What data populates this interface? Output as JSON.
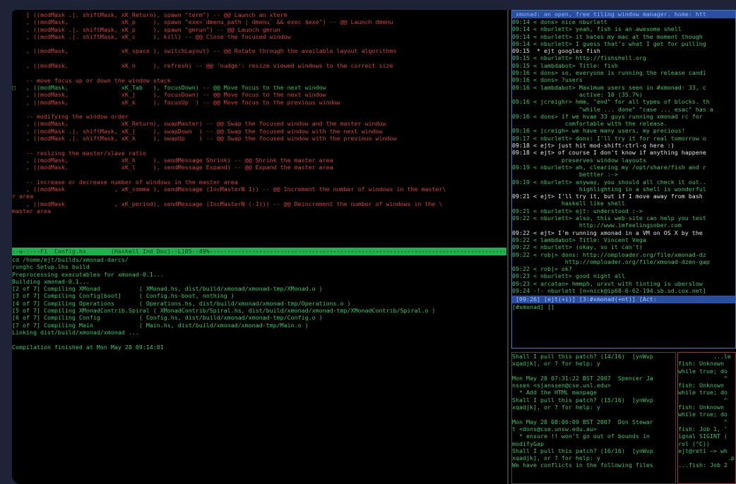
{
  "emacs": {
    "code_lines": [
      "    [ ((modMask .|. shiftMask, xK_Return), spawn \"term\") -- @@ Launch an xterm",
      "    , ((modMask,               xK_p     ), spawn \"exe=`dmenu_path | dmenu` && exec $exe\") -- @@ Launch dmenu",
      "    , ((modMask .|. shiftMask, xK_p     ), spawn \"gmrun\") -- @@ Launch gmrun",
      "    , ((modMask .|. shiftMask, xK_c     ), kill) -- @@ Close the focused window",
      "",
      "    , ((modMask,               xK_space ), switchLayout) -- @@ Rotate through the available layout algorithms",
      "",
      "    , ((modMask,               xK_n     ), refresh) -- @@ 'nudge': resize viewed windows to the correct size",
      "",
      "    -- move focus up or down the window stack",
      "□   , ((modMask,               xK_Tab   ), focusDown) -- @@ Move focus to the next window",
      "    , ((modMask,               xK_j     ), focusDown) -- @@ Move focus to the next window",
      "    , ((modMask,               xK_k     ), focusUp  ) -- @@ Move focus to the previous window",
      "",
      "    -- modifying the window order",
      "    , ((modMask,               xK_Return), swapMaster) -- @@ Swap the focused window and the master window",
      "    , ((modMask .|. shiftMask, xK_j     ), swapDown  ) -- @@ Swap the focused window with the next window",
      "    , ((modMask .|. shiftMask, xK_k     ), swapUp    ) -- @@ Swap the focused window with the previous window",
      "",
      "    -- resizing the master/slave ratio",
      "    , ((modMask,               xK_h     ), sendMessage Shrink) -- @@ Shrink the master area",
      "    , ((modMask,               xK_l     ), sendMessage Expand) -- @@ Expand the master area",
      "",
      "    -- increase or decrease number of windows in the master area",
      "    , ((modMask              , xK_comma ), sendMessage (IncMasterN 1)) -- @@ Increment the number of windows in the master\\",
      "r area",
      "    , ((modMask              , xK_period), sendMessage (IncMasterN (-1))) -- @@ Deincrement the number of windows in the \\",
      "master area"
    ],
    "modeline": "--u-:---F1  Config.hs       (Haskell Ind Doc)--L105--49%-------------------------------------------------------------------------------------",
    "compile_lines": [
      "cd /home/ejt/builds/xmonad-darcs/",
      "runghc Setup.lhs build",
      "Preprocessing executables for xmonad-0.1...",
      "Building xmonad-0.1...",
      "[2 of 7] Compiling XMonad           ( XMonad.hs, dist/build/xmonad/xmonad-tmp/XMonad.o )",
      "[3 of 7] Compiling Config[boot]     ( Config.hs-boot, nothing )",
      "[4 of 7] Compiling Operations       ( Operations.hs, dist/build/xmonad/xmonad-tmp/Operations.o )",
      "[5 of 7] Compiling XMonadContrib.Spiral ( XMonadContrib/Spiral.hs, dist/build/xmonad/xmonad-tmp/XMonadContrib/Spiral.o )",
      "[6 of 7] Compiling Config           ( Config.hs, dist/build/xmonad/xmonad-tmp/Config.o )",
      "[7 of 7] Compiling Main             ( Main.hs, dist/build/xmonad/xmonad-tmp/Main.o )",
      "Linking dist/build/xmonad/xmonad ...",
      "",
      "Compilation finished at Mon May 28 09:14:01"
    ]
  },
  "irc": {
    "topic": " xmonad: an open, free tiling window manager. home: htt",
    "messages": [
      "09:14 < dons> nice nburlett",
      "09:14 < nburlett> yeah, fish is an awesome shell",
      "09:14 < nburlett> it hates my mac at the moment though",
      "09:14 < nburlett> I guess that's what I get for pulling",
      "09:15  * ejt googles fish",
      "09:15 < nburlett> http://fishshell.org",
      "09:15 < lambdabot> Title: fish",
      "09:16 < dons> so, everyone is running the release candi",
      "09:16 < dons> ?users",
      "09:16 < lambdabot> Maximum users seen in #xmonad: 33, c",
      "                   active: 10 (35.7%)",
      "09:16 < jcreighr> hmm, \"end\" for all types of blocks. th",
      "                   \"while ... done\" \"case ... esac\" has a",
      "09:16 < dons> if we hvae 33 guys running xmonad rc for",
      "               comfortable with the release.",
      "09:16 < jcreigh> we have many users, my precious!",
      "09:17 < nburlett> dons: I'll try it for real tomorrow o",
      "09:18 < ejt> just hit mod-shift-ctrl-q here :)",
      "09:18 < ejt> of course I don't know if anything happene",
      "              preserves window layouts",
      "09:19 < nburlett> ah, clearing my /opt/share/fish and r",
      "                   bettter :->",
      "09:19 < nburlett> anyway, you should all check it out..",
      "                   highlighting in a shell is wonderful",
      "09:21 < ejt> I'll try it, but if I move away from bash",
      "              haskell like shell",
      "09:21 < nburlett> ejt: understood :->",
      "09:22 < nburlett> also, this web-site can help you test",
      "                   http://www.imfeelingsober.com",
      "09:22 < ejt> I'm running xmonad in a VM on OS X by the",
      "09:22 < lambdabot> Title: Vincent Vega",
      "09:22 < nburlett> (okay, so it can't)",
      "09:22 < rob|> dons: http://omploader.org/file/xmonad-dz",
      "               http://omploader.org/file/xmonad-dzen-gap",
      "09:22 < rob|> ok?",
      "09:23 < nburlett> good night all",
      "09:23 < arcatan> hmmph, urxvt with tinting is uberslow",
      "09:24 -!- nburlett [n=nick@ip68-6-62-194.sb.sd.cox.net]"
    ],
    "status": " [09:26] [ejt(+i)] [3:#xmonad(+nt)] [Act: ",
    "input": "[#xmonad] []"
  },
  "darcs": {
    "lines": [
      "Shall I pull this patch? (14/16)  [ynWvp",
      "xqadjk], or ? for help: y",
      "",
      "Mon May 28 07:31:22 BST 2007  Spencer Ja",
      "nssen <sjanssen@cse.unl.edu>",
      "  * Add the HTML manpage",
      "Shall I pull this patch? (15/16)  [ynWvp",
      "xqadjk], or ? for help: y",
      "",
      "Mon May 28 08:06:09 BST 2007  Don Stewar",
      "t <dons@cse.unsw.edu.au>",
      "  * ensure !! won't go out of bounds in",
      "modifyGap",
      "Shall I pull this patch? (16/16)  [ynWvp",
      "xqadjk], or ? for help: y",
      "We have conflicts in the following files"
    ]
  },
  "fish": {
    "lines": [
      "          ...le",
      "fish: Unknown",
      "while true; do",
      "             ^",
      "fish: Unknown",
      "while true; do",
      "             ^",
      "fish: Unknown",
      "while true; do",
      "             ^",
      "fish: Job 1, '",
      "ignal SIGINT (",
      "rol (^C))",
      "ejt@reti ~> wh",
      "              .p",
      "...fish: Job 2"
    ]
  }
}
